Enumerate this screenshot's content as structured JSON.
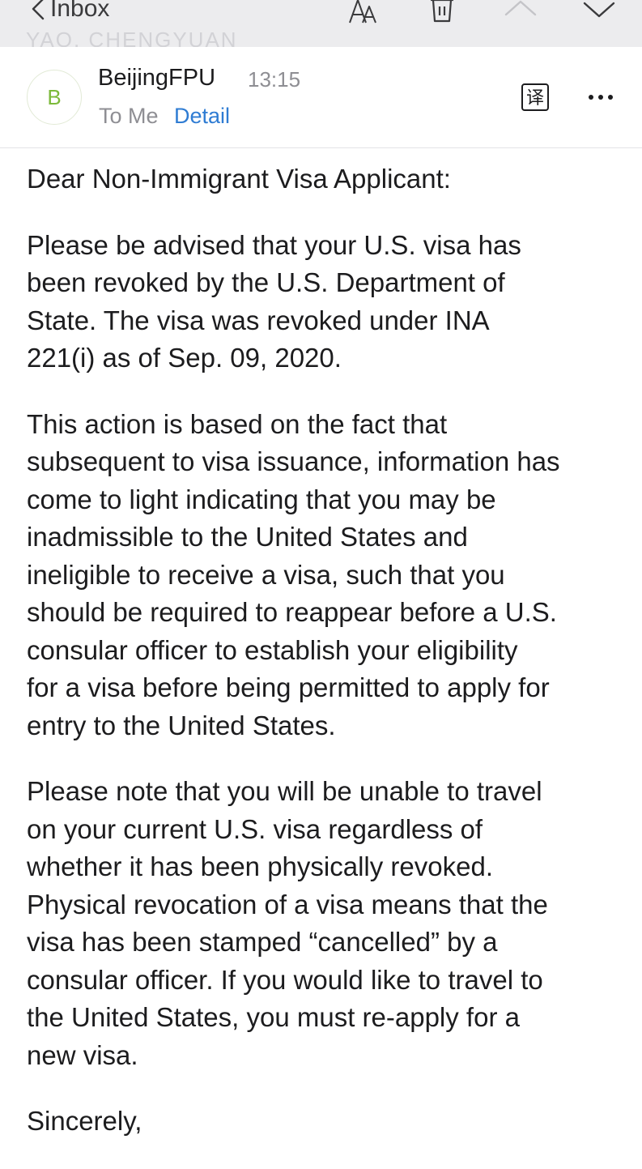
{
  "toolbar": {
    "back_label": "Inbox",
    "ghost_subject": "YAO, CHENGYUAN",
    "icons": [
      "font-size-icon",
      "trash-icon",
      "chevron-up-icon",
      "chevron-down-icon"
    ]
  },
  "sender": {
    "avatar_letter": "B",
    "name": "BeijingFPU",
    "time": "13:15",
    "to_label": "To Me",
    "detail_label": "Detail",
    "translate_icon_glyph": "译"
  },
  "colors": {
    "toolbar_bg": "#ececee",
    "link_blue": "#2f7cd3",
    "avatar_green": "#7cba3a",
    "muted_gray": "#8e8e93"
  },
  "email_body": {
    "greeting": "Dear Non-Immigrant Visa Applicant:",
    "paragraph_1": "Please be advised that your U.S. visa has\nbeen revoked by the U.S. Department of\nState.  The visa was revoked under INA\n221(i) as of Sep. 09, 2020.",
    "paragraph_2": "This action is based on the fact that\nsubsequent to visa issuance, information has\ncome to light indicating that you may be\ninadmissible to the United States and\nineligible to receive a visa, such that you\nshould be required to reappear before a U.S.\nconsular officer to establish your eligibility\nfor a visa before being permitted to apply for\nentry to the United States.",
    "paragraph_3": "Please note that you will be unable to travel\non your current U.S. visa regardless of\nwhether it has been physically revoked.\nPhysical revocation of a visa means that the\nvisa has been stamped “cancelled” by a\nconsular officer.  If you would like to travel to\nthe United States, you must re-apply for a\nnew visa.",
    "closing": "Sincerely,"
  }
}
